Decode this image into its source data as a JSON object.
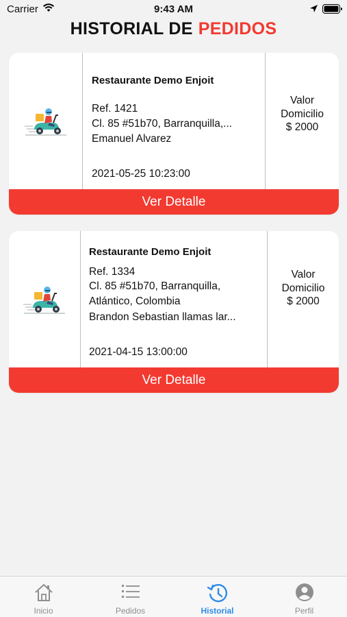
{
  "status_bar": {
    "carrier": "Carrier",
    "time": "9:43 AM"
  },
  "header": {
    "title_main": "HISTORIAL DE",
    "title_accent": "PEDIDOS",
    "accent_color": "#f23a30"
  },
  "orders": [
    {
      "restaurant": "Restaurante Demo Enjoit",
      "ref": "Ref. 1421",
      "address_lines": [
        "Cl. 85 #51b70, Barranquilla,..."
      ],
      "customer": "Emanuel Alvarez",
      "datetime": "2021-05-25 10:23:00",
      "value_label_1": "Valor",
      "value_label_2": "Domicilio",
      "value_amount": "$ 2000",
      "button_label": "Ver Detalle",
      "image_icon": "delivery-scooter-icon"
    },
    {
      "restaurant": "Restaurante Demo Enjoit",
      "ref": "Ref. 1334",
      "address_lines": [
        "Cl. 85 #51b70, Barranquilla,",
        "Atlántico, Colombia"
      ],
      "customer": "Brandon Sebastian llamas lar...",
      "datetime": "2021-04-15 13:00:00",
      "value_label_1": "Valor",
      "value_label_2": "Domicilio",
      "value_amount": "$ 2000",
      "button_label": "Ver Detalle",
      "image_icon": "delivery-scooter-icon"
    }
  ],
  "tab_bar": {
    "active_color": "#2c8be6",
    "tabs": [
      {
        "label": "Inicio",
        "icon": "home-icon"
      },
      {
        "label": "Pedidos",
        "icon": "list-icon"
      },
      {
        "label": "Historial",
        "icon": "history-icon",
        "active": true
      },
      {
        "label": "Perfil",
        "icon": "profile-icon"
      }
    ]
  }
}
